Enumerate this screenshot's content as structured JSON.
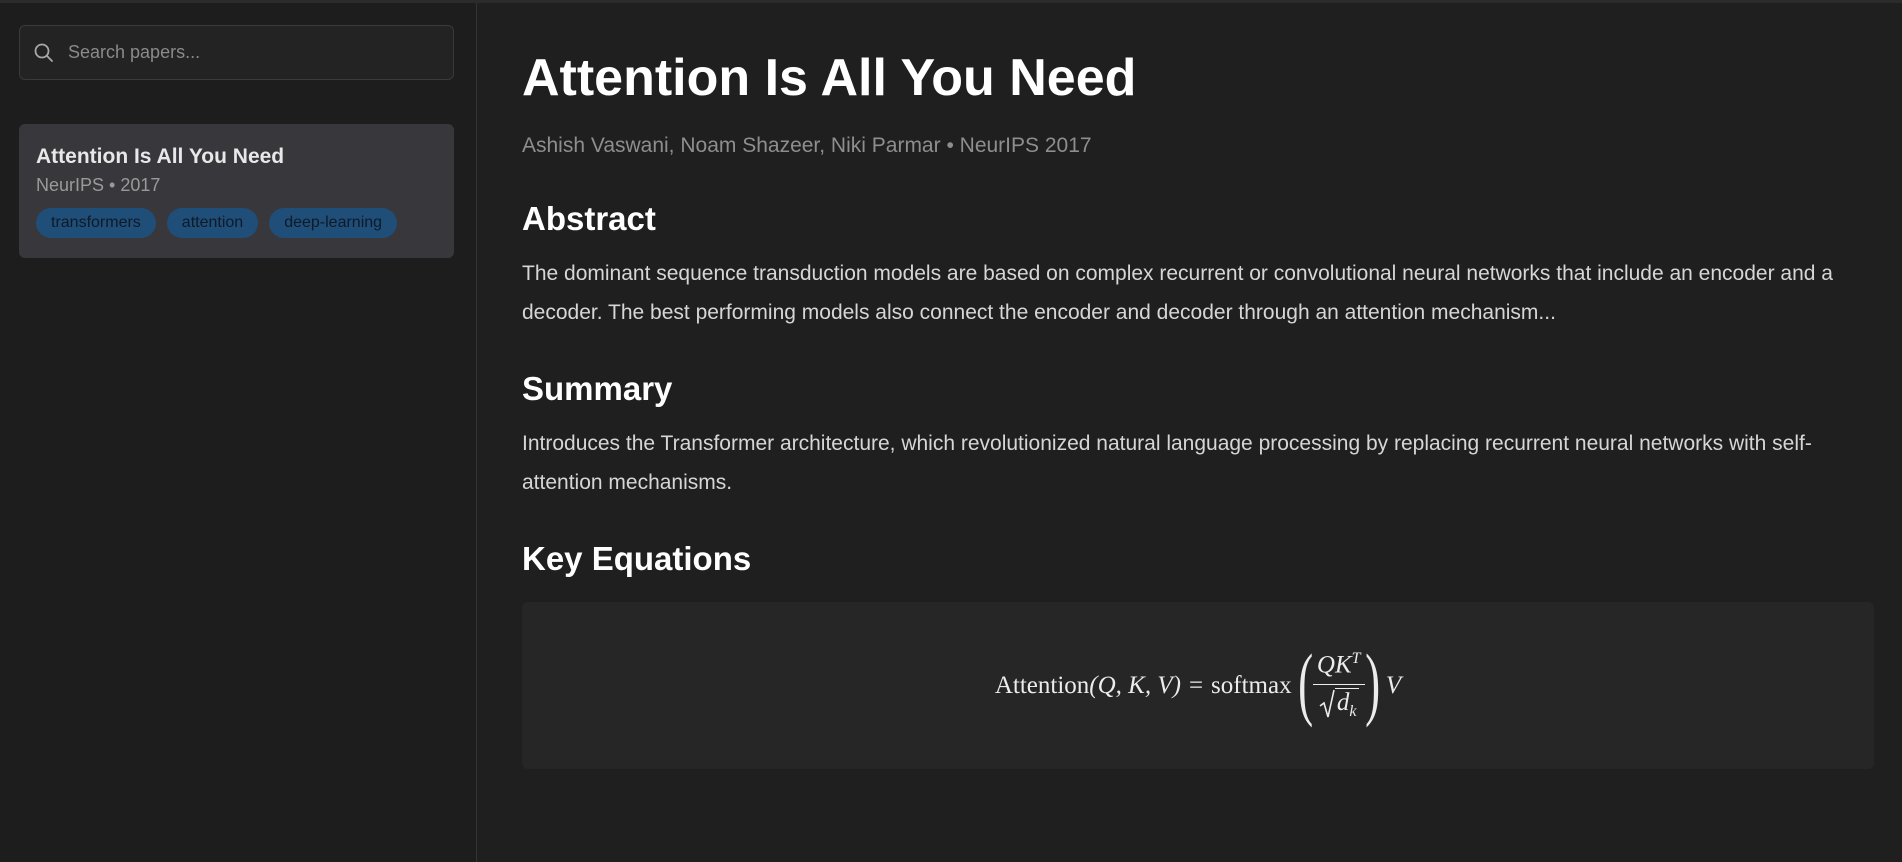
{
  "sidebar": {
    "search": {
      "placeholder": "Search papers...",
      "icon": "search-icon"
    },
    "papers": [
      {
        "title": "Attention Is All You Need",
        "venue": "NeurIPS",
        "separator": "•",
        "year": "2017",
        "tags": [
          "transformers",
          "attention",
          "deep-learning"
        ]
      }
    ]
  },
  "paper": {
    "title": "Attention Is All You Need",
    "authors": "Ashish Vaswani, Noam Shazeer, Niki Parmar",
    "separator": "•",
    "venue_year": "NeurIPS 2017",
    "abstract_heading": "Abstract",
    "abstract": "The dominant sequence transduction models are based on complex recurrent or convolutional neural networks that include an encoder and a decoder. The best performing models also connect the encoder and decoder through an attention mechanism...",
    "summary_heading": "Summary",
    "summary": "Introduces the Transformer architecture, which revolutionized natural language processing by replacing recurrent neural networks with self-attention mechanisms.",
    "equations_heading": "Key Equations",
    "equation": {
      "function": "Attention",
      "args": "(Q, K, V)",
      "equals": "=",
      "softmax": "softmax",
      "numerator": "QK",
      "superscript": "T",
      "denominator_var": "d",
      "denominator_sub": "k",
      "trailing": "V"
    }
  },
  "colors": {
    "background": "#1f1f1f",
    "card": "#38373c",
    "tag": "#1f4e79",
    "equation_box": "#262626"
  }
}
